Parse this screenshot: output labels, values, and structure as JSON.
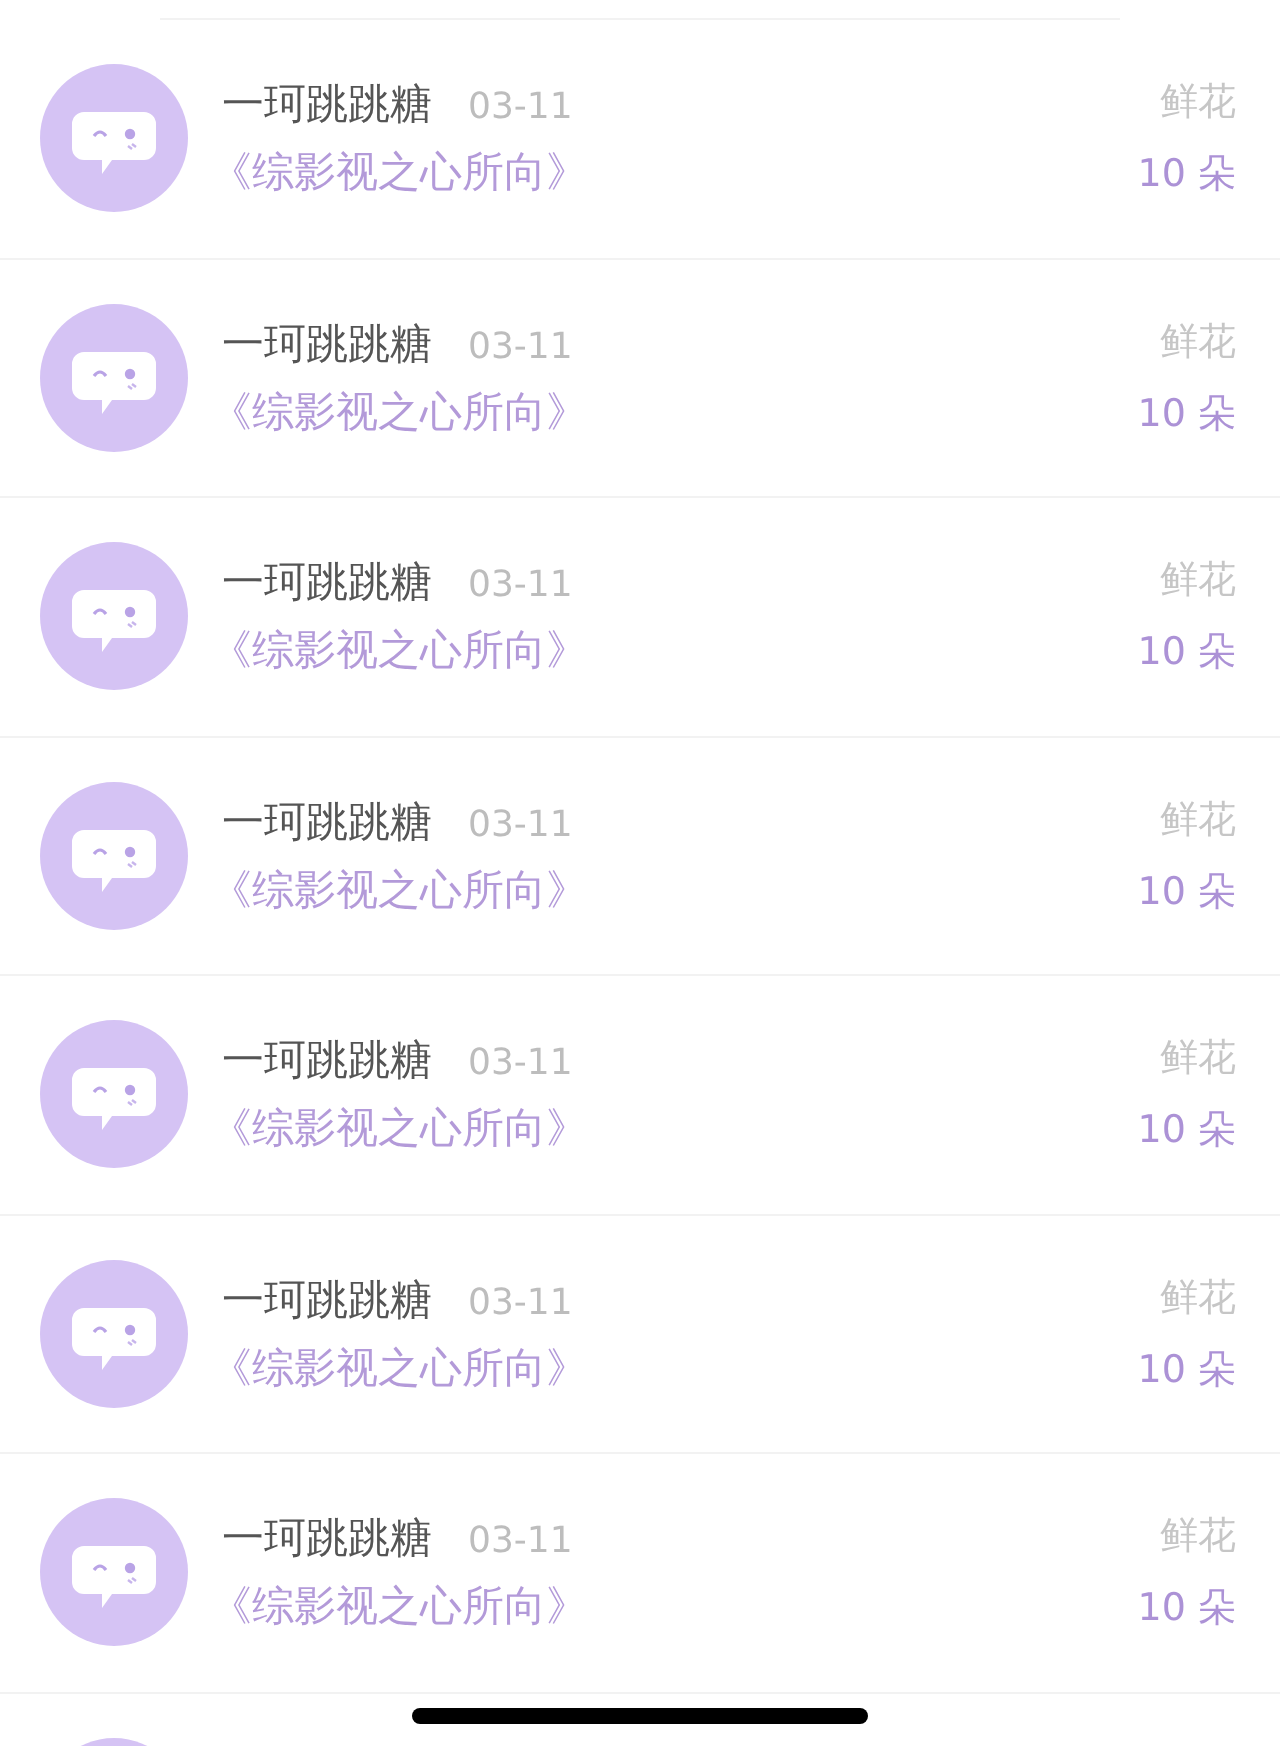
{
  "gifts": [
    {
      "user": "一珂跳跳糖",
      "date": "03-11",
      "book": "《综影视之心所向》",
      "gift_type": "鲜花",
      "count": "10 朵"
    },
    {
      "user": "一珂跳跳糖",
      "date": "03-11",
      "book": "《综影视之心所向》",
      "gift_type": "鲜花",
      "count": "10 朵"
    },
    {
      "user": "一珂跳跳糖",
      "date": "03-11",
      "book": "《综影视之心所向》",
      "gift_type": "鲜花",
      "count": "10 朵"
    },
    {
      "user": "一珂跳跳糖",
      "date": "03-11",
      "book": "《综影视之心所向》",
      "gift_type": "鲜花",
      "count": "10 朵"
    },
    {
      "user": "一珂跳跳糖",
      "date": "03-11",
      "book": "《综影视之心所向》",
      "gift_type": "鲜花",
      "count": "10 朵"
    },
    {
      "user": "一珂跳跳糖",
      "date": "03-11",
      "book": "《综影视之心所向》",
      "gift_type": "鲜花",
      "count": "10 朵"
    },
    {
      "user": "一珂跳跳糖",
      "date": "03-11",
      "book": "《综影视之心所向》",
      "gift_type": "鲜花",
      "count": "10 朵"
    }
  ]
}
